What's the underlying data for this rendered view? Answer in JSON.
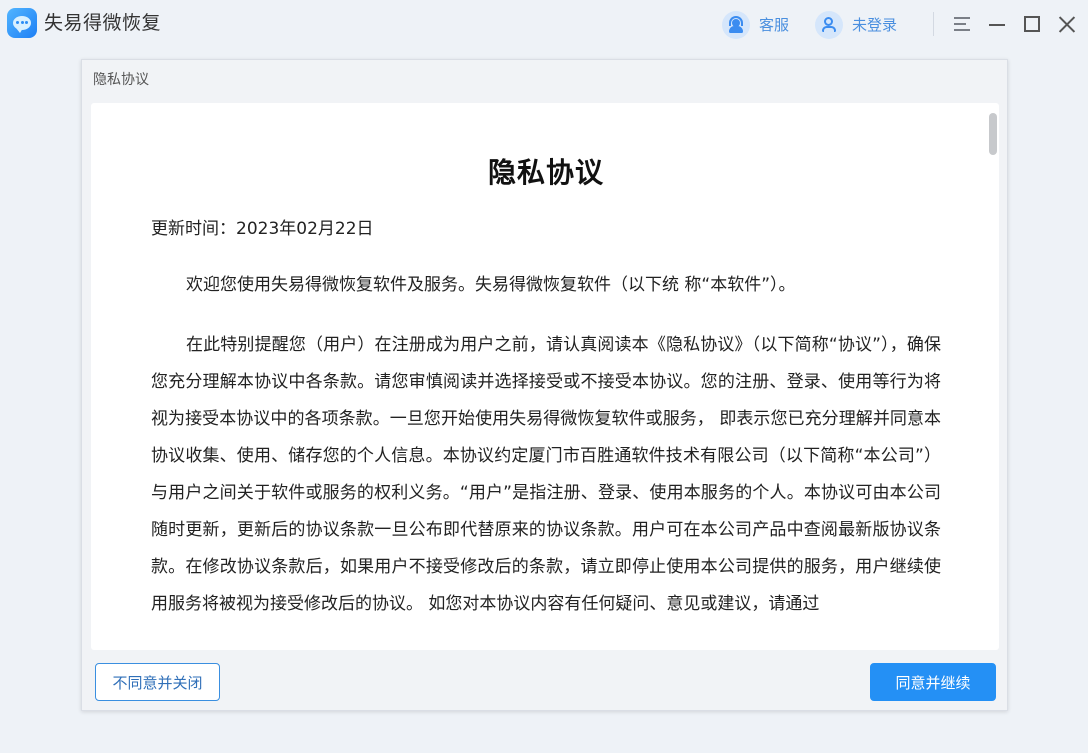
{
  "app": {
    "title": "失易得微恢复",
    "customer_service_label": "客服",
    "login_label": "未登录"
  },
  "dialog": {
    "title": "隐私协议",
    "document": {
      "heading": "隐私协议",
      "update_date": "更新时间：2023年02月22日",
      "paragraphs": [
        "欢迎您使用失易得微恢复软件及服务。失易得微恢复软件（以下统 称“本软件”）。",
        "在此特别提醒您（用户）在注册成为用户之前，请认真阅读本《隐私协议》（以下简称“协议”），确保您充分理解本协议中各条款。请您审慎阅读并选择接受或不接受本协议。您的注册、登录、使用等行为将视为接受本协议中的各项条款。一旦您开始使用失易得微恢复软件或服务， 即表示您已充分理解并同意本协议收集、使用、储存您的个人信息。本协议约定厦门市百胜通软件技术有限公司（以下简称“本公司”）与用户之间关于软件或服务的权利义务。“用户”是指注册、登录、使用本服务的个人。本协议可由本公司随时更新，更新后的协议条款一旦公布即代替原来的协议条款。用户可在本公司产品中查阅最新版协议条款。在修改协议条款后，如果用户不接受修改后的条款，请立即停止使用本公司提供的服务，用户继续使用服务将被视为接受修改后的协议。 如您对本协议内容有任何疑问、意见或建议，请通过"
      ]
    },
    "buttons": {
      "disagree": "不同意并关闭",
      "agree": "同意并继续"
    }
  },
  "colors": {
    "accent": "#2490f5",
    "link_text": "#4a8fdf",
    "background": "#eef2f7"
  }
}
